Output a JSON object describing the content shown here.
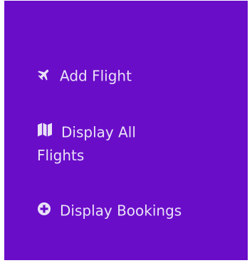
{
  "sidebar": {
    "items": [
      {
        "label": "Add Flight",
        "icon": "airplane-icon"
      },
      {
        "label_line1": "Display All",
        "label_line2": "Flights",
        "icon": "map-icon"
      },
      {
        "label": "Display Bookings",
        "icon": "plus-circle-icon"
      }
    ],
    "colors": {
      "background": "#6a0dc9",
      "text": "#e9e2f7"
    }
  }
}
